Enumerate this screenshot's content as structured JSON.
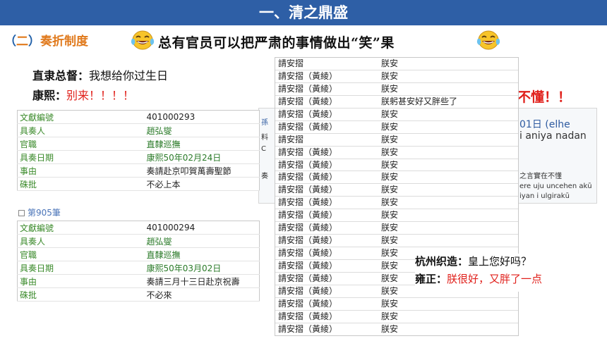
{
  "title": "一、清之鼎盛",
  "section": {
    "open": "（",
    "num": "二",
    "close": "）",
    "label": "奏折制度"
  },
  "headline": "总有官员可以把严肃的事情做出“笑”果",
  "dialog1": {
    "speaker1": "直隶总督：",
    "text1": "我想给你过生日",
    "speaker2": "康熙：",
    "text2": "别来！！！！"
  },
  "doc1": [
    {
      "label": "文獻編號",
      "value": "401000293",
      "style": "plain"
    },
    {
      "label": "具奏人",
      "value": "趙弘燮",
      "style": "link"
    },
    {
      "label": "官職",
      "value": "直隸巡撫",
      "style": "link"
    },
    {
      "label": "具奏日期",
      "value": "康熙50年02月24日",
      "style": "link"
    },
    {
      "label": "事由",
      "value": "奏請赴京叩賀萬壽聖節",
      "style": "plain"
    },
    {
      "label": "硃批",
      "value": "不必上本",
      "style": "plain"
    }
  ],
  "entry_count": "第905筆",
  "doc2": [
    {
      "label": "文獻編號",
      "value": "401000294",
      "style": "plain"
    },
    {
      "label": "具奏人",
      "value": "趙弘燮",
      "style": "link"
    },
    {
      "label": "官職",
      "value": "直隸巡撫",
      "style": "link"
    },
    {
      "label": "具奏日期",
      "value": "康熙50年03月02日",
      "style": "link"
    },
    {
      "label": "事由",
      "value": "奏請三月十三日赴京祝壽",
      "style": "plain"
    },
    {
      "label": "硃批",
      "value": "不必來",
      "style": "plain"
    }
  ],
  "background": {
    "red_text": "不懂！！",
    "date_text": "01日 (elhe",
    "manchu_text": "i aniya nadan",
    "small_cn": "之言實在不懂",
    "manchu2": "ere uju uncehen akū",
    "manchu3": "iyan i ulgirakū",
    "left_frags": [
      "孫",
      "料",
      "C",
      "奏"
    ]
  },
  "list": [
    {
      "c1": "請安摺",
      "c2": "朕安"
    },
    {
      "c1": "請安摺（黃綾）",
      "c2": "朕安"
    },
    {
      "c1": "請安摺（黃綾）",
      "c2": "朕安"
    },
    {
      "c1": "請安摺（黃綾）",
      "c2": "朕躬甚安好又胖些了"
    },
    {
      "c1": "請安摺（黃綾）",
      "c2": "朕安"
    },
    {
      "c1": "請安摺（黃綾）",
      "c2": "朕安"
    },
    {
      "c1": "請安摺",
      "c2": "朕安"
    },
    {
      "c1": "請安摺（黃綾）",
      "c2": "朕安"
    },
    {
      "c1": "請安摺（黃綾）",
      "c2": "朕安"
    },
    {
      "c1": "請安摺（黃綾）",
      "c2": "朕安"
    },
    {
      "c1": "請安摺（黃綾）",
      "c2": "朕安"
    },
    {
      "c1": "請安摺（黃綾）",
      "c2": "朕安"
    },
    {
      "c1": "請安摺（黃綾）",
      "c2": "朕安"
    },
    {
      "c1": "請安摺（黃綾）",
      "c2": "朕安"
    },
    {
      "c1": "請安摺（黃綾）",
      "c2": "朕安"
    },
    {
      "c1": "請安摺（黃綾）",
      "c2": "朕安"
    },
    {
      "c1": "請安摺（黃綾）",
      "c2": "朕安"
    },
    {
      "c1": "請安摺（黃綾）",
      "c2": "朕安"
    },
    {
      "c1": "請安摺（黃綾）",
      "c2": "朕安"
    },
    {
      "c1": "請安摺（黃綾）",
      "c2": "朕安"
    },
    {
      "c1": "請安摺（黃綾）",
      "c2": "朕安"
    },
    {
      "c1": "請安摺（黃綾）",
      "c2": "朕安"
    }
  ],
  "dialog2": {
    "speaker1": "杭州织造：",
    "text1": "皇上您好吗？",
    "speaker2": "雍正：",
    "text2": "朕很好，又胖了一点"
  },
  "colors": {
    "title_bg": "#2e5fa6",
    "accent_orange": "#e07a1d",
    "accent_red": "#e0201b",
    "label_green": "#3a8a2a"
  },
  "icons": [
    "laughing-tears-emoji-left",
    "laughing-tears-emoji-right",
    "checkbox-icon"
  ]
}
